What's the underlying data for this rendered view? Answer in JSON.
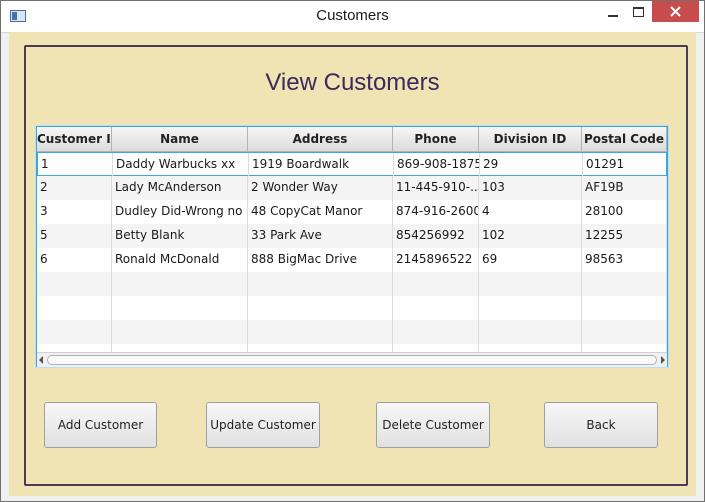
{
  "window": {
    "title": "Customers"
  },
  "view": {
    "heading": "View Customers"
  },
  "table": {
    "columns": [
      "Customer ID",
      "Name",
      "Address",
      "Phone",
      "Division ID",
      "Postal Code"
    ],
    "rows": [
      [
        "1",
        "Daddy Warbucks xx",
        "1919 Boardwalk",
        "869-908-1875",
        "29",
        "01291"
      ],
      [
        "2",
        "Lady McAnderson",
        "2 Wonder Way",
        "11-445-910-...",
        "103",
        "AF19B"
      ],
      [
        "3",
        "Dudley Did-Wrong no",
        "48 CopyCat Manor",
        "874-916-2600",
        "4",
        "28100"
      ],
      [
        "5",
        "Betty Blank",
        "33 Park Ave",
        "854256992",
        "102",
        "12255"
      ],
      [
        "6",
        "Ronald McDonald",
        "888 BigMac Drive",
        "2145896522",
        "69",
        "98563"
      ]
    ]
  },
  "buttons": {
    "add": "Add Customer",
    "update": "Update Customer",
    "delete": "Delete Customer",
    "back": "Back"
  },
  "icons": {
    "app": "app-window-icon",
    "minimize": "minimize-icon",
    "maximize": "maximize-icon",
    "close": "close-icon"
  },
  "colors": {
    "background": "#f0e3b4",
    "heading": "#3b2a5c",
    "selection_border": "#39a7e0",
    "close_button": "#c74d4d"
  }
}
